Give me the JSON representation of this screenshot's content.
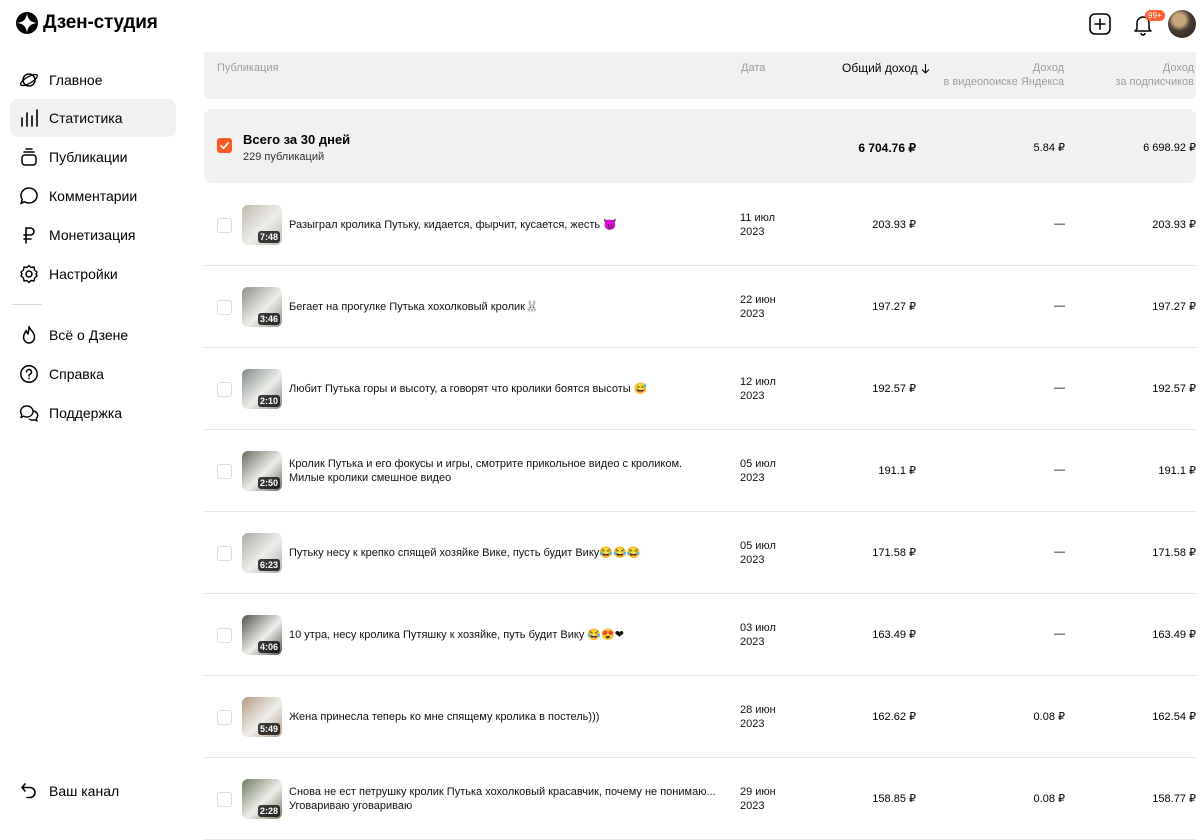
{
  "app": {
    "title": "Дзен-студия"
  },
  "header": {
    "badge": "99+"
  },
  "sidebar": {
    "items": [
      {
        "label": "Главное",
        "icon": "planet-icon"
      },
      {
        "label": "Статистика",
        "icon": "bar-chart-icon",
        "active": true
      },
      {
        "label": "Публикации",
        "icon": "stack-icon"
      },
      {
        "label": "Комментарии",
        "icon": "comment-icon"
      },
      {
        "label": "Монетизация",
        "icon": "ruble-icon"
      },
      {
        "label": "Настройки",
        "icon": "gear-icon"
      },
      {
        "label": "Всё о Дзене",
        "icon": "flame-icon"
      },
      {
        "label": "Справка",
        "icon": "help-icon"
      },
      {
        "label": "Поддержка",
        "icon": "chat-icon"
      }
    ],
    "channel_label": "Ваш канал"
  },
  "table": {
    "headers": {
      "publication": "Публикация",
      "date": "Дата",
      "total": "Общий доход",
      "video_line1": "Доход",
      "video_line2": "в видеопоиске Яндекса",
      "subs_line1": "Доход",
      "subs_line2": "за подписчиков"
    },
    "summary": {
      "title": "Всего за 30 дней",
      "subtitle": "229 публикаций",
      "total": "6 704.76 ₽",
      "video": "5.84 ₽",
      "subs": "6 698.92 ₽"
    },
    "rows": [
      {
        "title": "Разыграл кролика Путьку, кидается, фырчит, кусается, жесть 😈",
        "date1": "11 июл",
        "date2": "2023",
        "duration": "7:48",
        "total": "203.93 ₽",
        "video": "—",
        "subs": "203.93 ₽",
        "thumb_color": "#bfb8ae"
      },
      {
        "title": "Бегает на прогулке Путька хохолковый кролик🐰",
        "date1": "22 июн",
        "date2": "2023",
        "duration": "3:46",
        "total": "197.27 ₽",
        "video": "—",
        "subs": "197.27 ₽",
        "thumb_color": "#8c8f84"
      },
      {
        "title": "Любит Путька горы и высоту, а говорят что кролики боятся высоты 😅",
        "date1": "12 июл",
        "date2": "2023",
        "duration": "2:10",
        "total": "192.57 ₽",
        "video": "—",
        "subs": "192.57 ₽",
        "thumb_color": "#7d8a87"
      },
      {
        "title": "Кролик Путька и его фокусы и игры, смотрите прикольное видео с кроликом. Милые кролики смешное видео",
        "date1": "05 июл",
        "date2": "2023",
        "duration": "2:50",
        "total": "191.1 ₽",
        "video": "—",
        "subs": "191.1 ₽",
        "thumb_color": "#6b6a60"
      },
      {
        "title": "Путьку несу к крепко спящей хозяйке Вике, пусть будит Вику😂😂😂",
        "date1": "05 июл",
        "date2": "2023",
        "duration": "6:23",
        "total": "171.58 ₽",
        "video": "—",
        "subs": "171.58 ₽",
        "thumb_color": "#a9aca6"
      },
      {
        "title": "10 утра, несу кролика Путяшку к хозяйке, путь будит Вику 😂😍❤",
        "date1": "03 июл",
        "date2": "2023",
        "duration": "4:06",
        "total": "163.49 ₽",
        "video": "—",
        "subs": "163.49 ₽",
        "thumb_color": "#55524d"
      },
      {
        "title": "Жена принесла теперь ко мне спящему кролика в постель)))",
        "date1": "28 июн",
        "date2": "2023",
        "duration": "5:49",
        "total": "162.62 ₽",
        "video": "0.08 ₽",
        "subs": "162.54 ₽",
        "thumb_color": "#b59a82"
      },
      {
        "title": "Снова не ест петрушку кролик Путька хохолковый красавчик, почему не понимаю... Уговариваю уговариваю",
        "date1": "29 июн",
        "date2": "2023",
        "duration": "2:28",
        "total": "158.85 ₽",
        "video": "0.08 ₽",
        "subs": "158.77 ₽",
        "thumb_color": "#6d7a5e"
      }
    ]
  },
  "colors": {
    "accent": "#fa5a28",
    "header_bg": "#f1f1ef"
  }
}
